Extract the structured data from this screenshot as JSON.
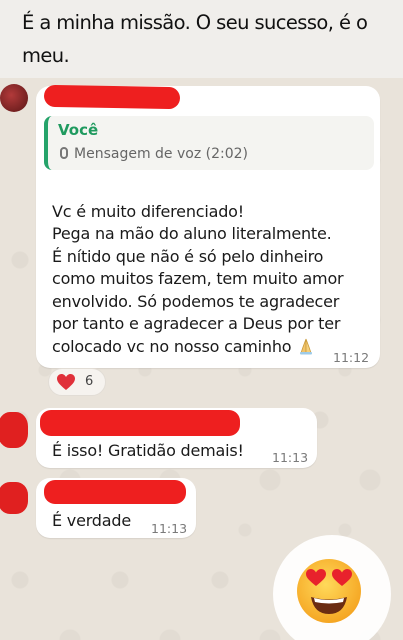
{
  "caption": {
    "line1": "É a minha missão. O seu sucesso, é o",
    "line2": "meu."
  },
  "messages": [
    {
      "quote_author": "Você",
      "quote_text": "Mensagem de voz (2:02)",
      "text": "Vc é muito diferenciado!\nPega na mão do aluno literalmente.\nÉ nítido que não é só pelo dinheiro\ncomo muitos fazem, tem muito amor\nenvolvido. Só podemos te agradecer\npor tanto e agradecer a Deus por ter\ncolocado vc no nosso caminho",
      "time": "11:12",
      "reaction_count": "6"
    },
    {
      "text": "É isso! Gratidão demais!",
      "time": "11:13"
    },
    {
      "text": "É verdade",
      "time": "11:13"
    }
  ],
  "colors": {
    "accent_green": "#1f9a5f",
    "redaction_red": "#ee1f1f",
    "bubble_bg": "#ffffff"
  },
  "icons": [
    "mic-icon",
    "pray-icon",
    "heart-icon",
    "heart-eyes-emoji-icon"
  ]
}
